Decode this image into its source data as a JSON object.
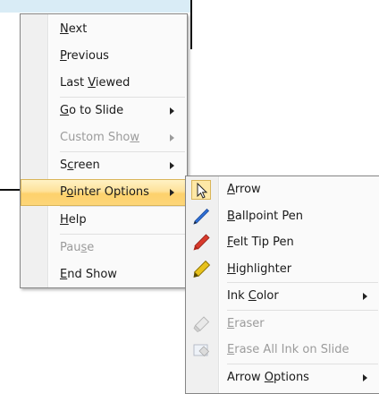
{
  "main_menu": {
    "items": [
      {
        "label": "Next",
        "mnemonic": "N",
        "rest": "ext"
      },
      {
        "label": "Previous",
        "mnemonic": "P",
        "rest": "revious"
      },
      {
        "label": "Last Viewed",
        "pre": "Last ",
        "mnemonic": "V",
        "rest": "iewed"
      },
      {
        "label": "Go to Slide",
        "mnemonic": "G",
        "rest": "o to Slide",
        "submenu": true
      },
      {
        "label": "Custom Show",
        "pre": "Custom Sho",
        "mnemonic": "w",
        "rest": "",
        "submenu": true,
        "disabled": true
      },
      {
        "label": "Screen",
        "pre": "S",
        "mnemonic": "c",
        "rest": "reen",
        "submenu": true
      },
      {
        "label": "Pointer Options",
        "pre": "P",
        "mnemonic": "o",
        "rest": "inter Options",
        "submenu": true,
        "highlighted": true
      },
      {
        "label": "Help",
        "mnemonic": "H",
        "rest": "elp"
      },
      {
        "label": "Pause",
        "pre": "Pau",
        "mnemonic": "s",
        "rest": "e",
        "disabled": true
      },
      {
        "label": "End Show",
        "mnemonic": "E",
        "rest": "nd Show"
      }
    ]
  },
  "pointer_submenu": {
    "items": [
      {
        "label": "Arrow",
        "mnemonic": "A",
        "rest": "rrow",
        "icon": "arrow-pointer-icon",
        "checked": true
      },
      {
        "label": "Ballpoint Pen",
        "mnemonic": "B",
        "rest": "allpoint Pen",
        "icon": "ballpoint-pen-icon"
      },
      {
        "label": "Felt Tip Pen",
        "mnemonic": "F",
        "rest": "elt Tip Pen",
        "icon": "felt-tip-pen-icon"
      },
      {
        "label": "Highlighter",
        "mnemonic": "H",
        "rest": "ighlighter",
        "icon": "highlighter-icon"
      },
      {
        "label": "Ink Color",
        "pre": "Ink ",
        "mnemonic": "C",
        "rest": "olor",
        "submenu": true
      },
      {
        "label": "Eraser",
        "mnemonic": "E",
        "rest": "raser",
        "icon": "eraser-icon",
        "disabled": true
      },
      {
        "label": "Erase All Ink on Slide",
        "mnemonic": "E",
        "rest": "rase All Ink on Slide",
        "icon": "erase-all-ink-icon",
        "disabled": true
      },
      {
        "label": "Arrow Options",
        "pre": "Arrow ",
        "mnemonic": "O",
        "rest": "ptions",
        "submenu": true
      }
    ]
  },
  "colors": {
    "highlight": "#fdd679",
    "ballpoint": "#2f6fd6",
    "felt_tip": "#d83a2c",
    "highlighter": "#e8c21b",
    "disabled_text": "#9b9b9b"
  }
}
